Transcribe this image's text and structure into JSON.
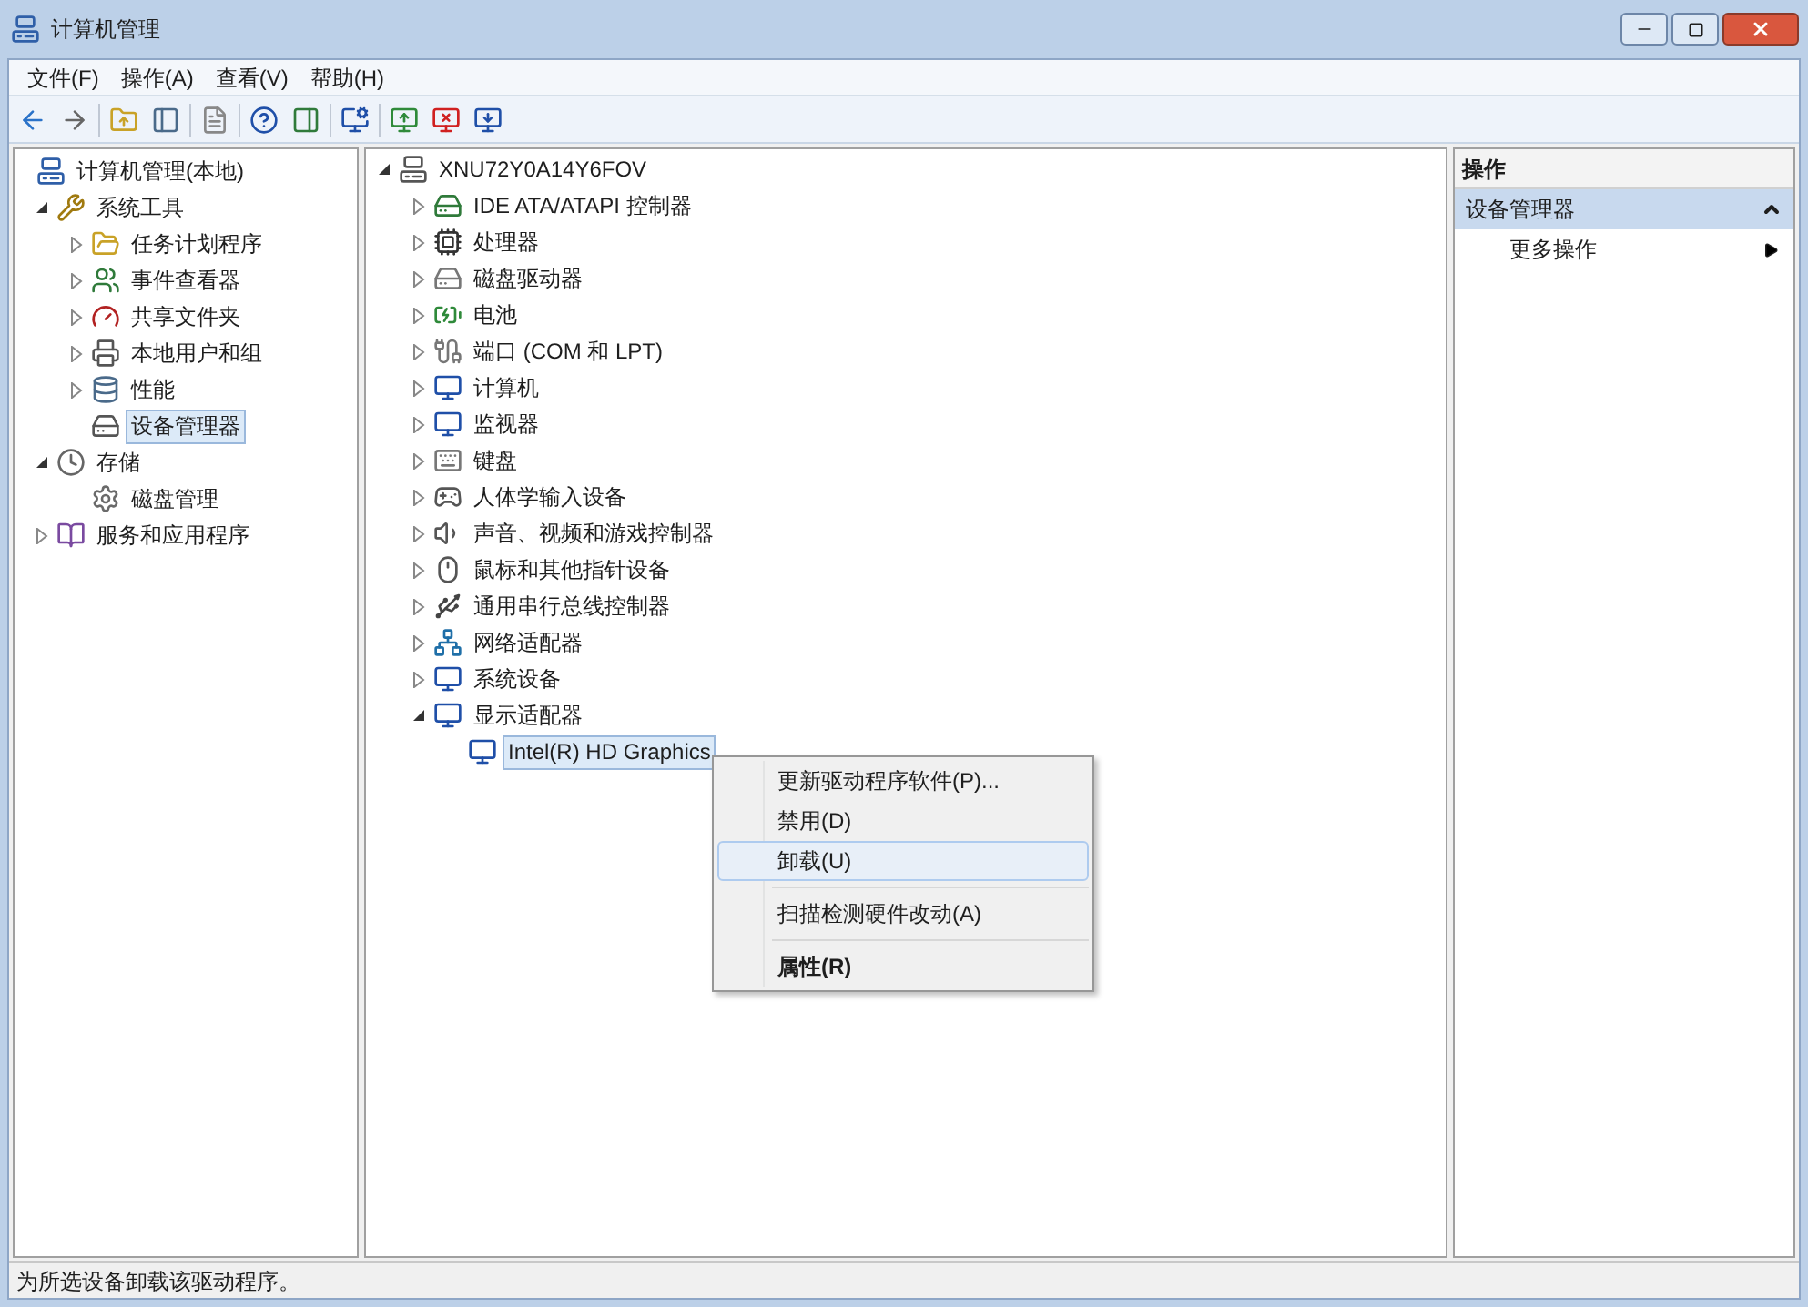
{
  "window": {
    "title": "计算机管理"
  },
  "menu_bar": [
    "文件(F)",
    "操作(A)",
    "查看(V)",
    "帮助(H)"
  ],
  "navigation_tree": {
    "items": [
      {
        "label": "计算机管理(本地)",
        "selected": false,
        "children": [
          {
            "label": "系统工具",
            "expanded": true,
            "selected": false,
            "children": [
              {
                "label": "任务计划程序",
                "expanded": false,
                "selected": false
              },
              {
                "label": "事件查看器",
                "expanded": false,
                "selected": false
              },
              {
                "label": "共享文件夹",
                "expanded": false,
                "selected": false
              },
              {
                "label": "本地用户和组",
                "expanded": false,
                "selected": false
              },
              {
                "label": "性能",
                "expanded": false,
                "selected": false
              },
              {
                "label": "设备管理器",
                "selected": true
              }
            ]
          },
          {
            "label": "存储",
            "expanded": true,
            "selected": false,
            "children": [
              {
                "label": "磁盘管理",
                "selected": false
              }
            ]
          },
          {
            "label": "服务和应用程序",
            "expanded": false,
            "selected": false
          }
        ]
      }
    ]
  },
  "device_tree": {
    "items": [
      {
        "label": "XNU72Y0A14Y6FOV",
        "expanded": true,
        "selected": false,
        "children": [
          {
            "label": "IDE ATA/ATAPI 控制器",
            "expanded": false,
            "selected": false
          },
          {
            "label": "处理器",
            "expanded": false,
            "selected": false
          },
          {
            "label": "磁盘驱动器",
            "expanded": false,
            "selected": false
          },
          {
            "label": "电池",
            "expanded": false,
            "selected": false
          },
          {
            "label": "端口 (COM 和 LPT)",
            "expanded": false,
            "selected": false
          },
          {
            "label": "计算机",
            "expanded": false,
            "selected": false
          },
          {
            "label": "监视器",
            "expanded": false,
            "selected": false
          },
          {
            "label": "键盘",
            "expanded": false,
            "selected": false
          },
          {
            "label": "人体学输入设备",
            "expanded": false,
            "selected": false
          },
          {
            "label": "声音、视频和游戏控制器",
            "expanded": false,
            "selected": false
          },
          {
            "label": "鼠标和其他指针设备",
            "expanded": false,
            "selected": false
          },
          {
            "label": "通用串行总线控制器",
            "expanded": false,
            "selected": false
          },
          {
            "label": "网络适配器",
            "expanded": false,
            "selected": false
          },
          {
            "label": "系统设备",
            "expanded": false,
            "selected": false
          },
          {
            "label": "显示适配器",
            "expanded": true,
            "selected": false,
            "children": [
              {
                "label": "Intel(R) HD Graphics",
                "selected": true
              }
            ]
          }
        ]
      }
    ]
  },
  "context_menu": {
    "items": [
      {
        "kind": "item",
        "label": "更新驱动程序软件(P)...",
        "selected": false,
        "bold": false
      },
      {
        "kind": "item",
        "label": "禁用(D)",
        "selected": false,
        "bold": false
      },
      {
        "kind": "item",
        "label": "卸载(U)",
        "selected": true,
        "bold": false
      },
      {
        "kind": "separator"
      },
      {
        "kind": "item",
        "label": "扫描检测硬件改动(A)",
        "selected": false,
        "bold": false
      },
      {
        "kind": "separator"
      },
      {
        "kind": "item",
        "label": "属性(R)",
        "selected": false,
        "bold": true
      }
    ]
  },
  "actions_pane": {
    "title": "操作",
    "sections": [
      {
        "label": "设备管理器",
        "expanded": true,
        "items": [
          {
            "label": "更多操作",
            "submenu": true
          }
        ]
      }
    ]
  },
  "status_bar": "为所选设备卸载该驱动程序。"
}
